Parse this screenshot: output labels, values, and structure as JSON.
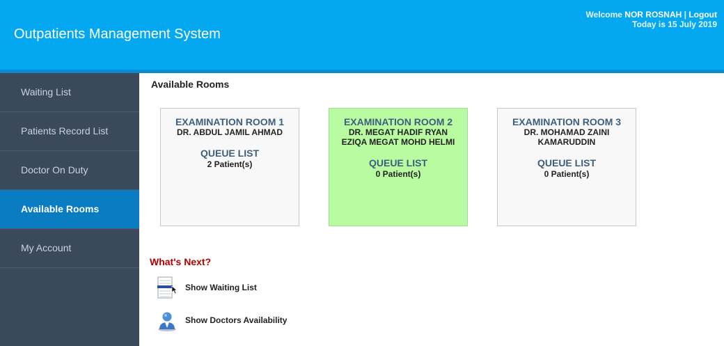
{
  "header": {
    "title": "Outpatients Management System",
    "welcome_prefix": "Welcome",
    "user_name": "NOR ROSNAH",
    "separator": "|",
    "logout_label": "Logout",
    "date_text": "Today is 15 July 2019"
  },
  "sidebar": {
    "items": [
      {
        "label": "Waiting List",
        "active": false
      },
      {
        "label": "Patients Record List",
        "active": false
      },
      {
        "label": "Doctor On Duty",
        "active": false
      },
      {
        "label": "Available Rooms",
        "active": true
      },
      {
        "label": "My Account",
        "active": false
      }
    ]
  },
  "main": {
    "section_title": "Available Rooms",
    "rooms": [
      {
        "name": "EXAMINATION ROOM 1",
        "doctor": "DR. ABDUL JAMIL AHMAD",
        "queue_label": "QUEUE LIST",
        "patients": "2 Patient(s)"
      },
      {
        "name": "EXAMINATION ROOM 2",
        "doctor": "DR. MEGAT HADIF RYAN EZIQA MEGAT MOHD HELMI",
        "queue_label": "QUEUE LIST",
        "patients": "0 Patient(s)",
        "highlight_color": "#b9fba1"
      },
      {
        "name": "EXAMINATION ROOM 3",
        "doctor": "DR. MOHAMAD ZAINI KAMARUDDIN",
        "queue_label": "QUEUE LIST",
        "patients": "0 Patient(s)"
      }
    ],
    "whats_next_title": "What's Next?",
    "actions": [
      {
        "label": "Show Waiting List",
        "icon": "waiting-list-icon"
      },
      {
        "label": "Show Doctors Availability",
        "icon": "doctor-icon"
      }
    ]
  },
  "colors": {
    "header_bg": "#04a8f0",
    "sidebar_bg": "#3a4a5c",
    "sidebar_active_bg": "#0a7cc1",
    "room_title": "#3d5e7e",
    "whats_next": "#b30000"
  }
}
